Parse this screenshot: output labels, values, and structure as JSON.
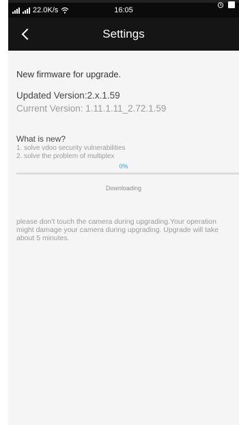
{
  "status_bar": {
    "network_speed": "22.0K/s",
    "time": "16:05"
  },
  "icons": {
    "back": "chevron-left-icon",
    "wifi": "wifi-icon",
    "alarm": "clock-icon",
    "battery": "battery-icon"
  },
  "header": {
    "title": "Settings"
  },
  "firmware": {
    "message": "New firmware for upgrade.",
    "updated_version": "Updated Version:2.x.1.59",
    "current_version": "Current Version: 1.11.1.11_2.72.1.59",
    "whats_new_title": "What is new?",
    "notes": [
      "1. solve vdoo security vulnerabilities",
      "2. solve the problem of multiplex"
    ]
  },
  "progress": {
    "percent_label": "0%",
    "value": 0,
    "status": "Downloading"
  },
  "warning": "please don't touch the camera during upgrading.Your operation might damage your camera during upgrading. Upgrade will take about 5 minutes.",
  "colors": {
    "accent": "#2aa3e8",
    "appbar": "#151515",
    "background": "#f5f5f5"
  }
}
